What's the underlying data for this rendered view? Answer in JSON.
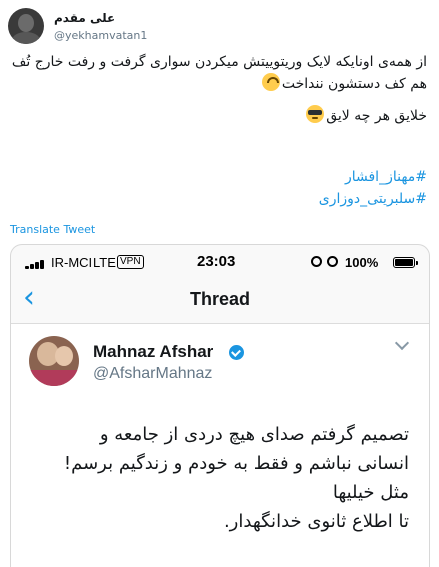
{
  "tweet": {
    "author_name": "علی مقدم",
    "author_handle": "@yekhamvatan1",
    "text_lines": [
      "از همه‌ی اونایکه لایک وریتوییتش میکردن سواری گرفت و رفت خارج تُف",
      "هم کف دستشون ننداخت"
    ],
    "text_line_2": "خلایق هر چه لایق",
    "hashtags": [
      "#مهناز_افشار",
      "#سلبریتی_دوزاری"
    ],
    "translate_label": "Translate Tweet"
  },
  "embedded_screenshot": {
    "status_bar": {
      "carrier": "IR-MCI",
      "network": "LTE",
      "vpn": "VPN",
      "time": "23:03",
      "battery": "100%"
    },
    "nav": {
      "back_icon": "chevron-left-icon",
      "title": "Thread"
    },
    "quoted_tweet": {
      "name": "Mahnaz Afshar",
      "handle": "@AfsharMahnaz",
      "verified": true,
      "text_lines": [
        "تصمیم گرفتم صدای هیچ دردی از جامعه و",
        "انسانی نباشم و فقط به خودم و زندگیم برسم!",
        "مثل خیلیها",
        "تا اطلاع ثانوی خدانگهدار."
      ]
    }
  },
  "colors": {
    "link": "#1b95e0",
    "text": "#14171a",
    "muted": "#657786"
  }
}
